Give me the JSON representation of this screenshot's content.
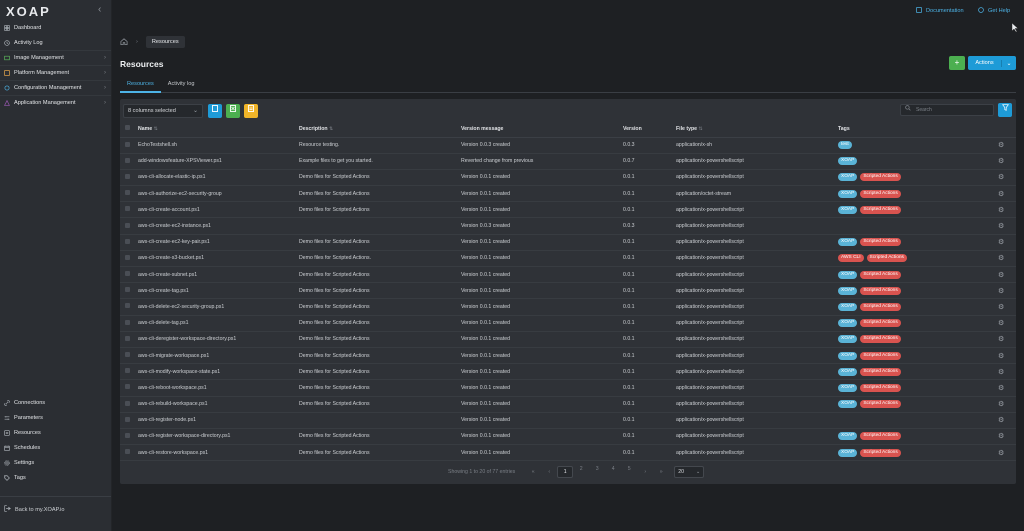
{
  "sidebar": {
    "logo": "XOAP",
    "collapse_glyph": "‹",
    "items": [
      {
        "label": "Dashboard",
        "icon": "dashboard-icon",
        "chev": false
      },
      {
        "label": "Activity Log",
        "icon": "activity-icon",
        "chev": false
      },
      {
        "label": "Image Management",
        "icon": "image-icon",
        "chev": true
      },
      {
        "label": "Platform Management",
        "icon": "platform-icon",
        "chev": true
      },
      {
        "label": "Configuration Management",
        "icon": "config-icon",
        "chev": true
      },
      {
        "label": "Application Management",
        "icon": "app-icon",
        "chev": true
      }
    ],
    "bottom_items": [
      {
        "label": "Connections",
        "icon": "link-icon"
      },
      {
        "label": "Parameters",
        "icon": "parameters-icon"
      },
      {
        "label": "Resources",
        "icon": "resources-icon"
      },
      {
        "label": "Schedules",
        "icon": "calendar-icon"
      },
      {
        "label": "Settings",
        "icon": "gear-icon"
      },
      {
        "label": "Tags",
        "icon": "tag-icon"
      }
    ],
    "back_label": "Back to my.XOAP.io"
  },
  "topbar": {
    "documentation": "Documentation",
    "help": "Get Help"
  },
  "breadcrumb": {
    "current": "Resources"
  },
  "page": {
    "title": "Resources",
    "add_label": "+",
    "actions_label": "Actions"
  },
  "tabs": [
    "Resources",
    "Activity log"
  ],
  "toolbar": {
    "columns_selected": "8 columns selected",
    "search_placeholder": "Search"
  },
  "table": {
    "headers": [
      "Name",
      "Description",
      "Version message",
      "Version",
      "File type",
      "Tags"
    ],
    "rows": [
      {
        "name": "EchoTestshell.sh",
        "description": "Resource testing.",
        "message": "Version 0.0.3 created",
        "version": "0.0.3",
        "type": "application/x-sh",
        "tags": [
          {
            "t": "test",
            "c": "#5ab3d6"
          }
        ]
      },
      {
        "name": "add-windowsfeature-XPSViewer.ps1",
        "description": "Example files to get you started.",
        "message": "Reverted change from previous",
        "version": "0.0.7",
        "type": "application/x-powershellscript",
        "tags": [
          {
            "t": "XOAP",
            "c": "#5ab3d6"
          }
        ]
      },
      {
        "name": "aws-cli-allocate-elastic-ip.ps1",
        "description": "Demo files for Scripted Actions",
        "message": "Version 0.0.1 created",
        "version": "0.0.1",
        "type": "application/x-powershellscript",
        "tags": [
          {
            "t": "XOAP",
            "c": "#5ab3d6"
          },
          {
            "t": "Scripted Actions",
            "c": "#d9534f"
          }
        ]
      },
      {
        "name": "aws-cli-authorize-ec2-security-group",
        "description": "Demo files for Scripted Actions",
        "message": "Version 0.0.1 created",
        "version": "0.0.1",
        "type": "application/octet-stream",
        "tags": [
          {
            "t": "XOAP",
            "c": "#5ab3d6"
          },
          {
            "t": "Scripted Actions",
            "c": "#d9534f"
          }
        ]
      },
      {
        "name": "aws-cli-create-account.ps1",
        "description": "Demo files for Scripted Actions",
        "message": "Version 0.0.1 created",
        "version": "0.0.1",
        "type": "application/x-powershellscript",
        "tags": [
          {
            "t": "XOAP",
            "c": "#5ab3d6"
          },
          {
            "t": "Scripted Actions",
            "c": "#d9534f"
          }
        ]
      },
      {
        "name": "aws-cli-create-ec2-instance.ps1",
        "description": "",
        "message": "Version 0.0.3 created",
        "version": "0.0.3",
        "type": "application/x-powershellscript",
        "tags": []
      },
      {
        "name": "aws-cli-create-ec2-key-pair.ps1",
        "description": "Demo files for Scripted Actions",
        "message": "Version 0.0.1 created",
        "version": "0.0.1",
        "type": "application/x-powershellscript",
        "tags": [
          {
            "t": "XOAP",
            "c": "#5ab3d6"
          },
          {
            "t": "Scripted Actions",
            "c": "#d9534f"
          }
        ]
      },
      {
        "name": "aws-cli-create-s3-bucket.ps1",
        "description": "Demo files for Scripted Actions.",
        "message": "Version 0.0.1 created",
        "version": "0.0.1",
        "type": "application/x-powershellscript",
        "tags": [
          {
            "t": "AWS CLI",
            "c": "#d9534f"
          },
          {
            "t": "Scripted Actions",
            "c": "#d9534f"
          }
        ]
      },
      {
        "name": "aws-cli-create-subnet.ps1",
        "description": "Demo files for Scripted Actions",
        "message": "Version 0.0.1 created",
        "version": "0.0.1",
        "type": "application/x-powershellscript",
        "tags": [
          {
            "t": "XOAP",
            "c": "#5ab3d6"
          },
          {
            "t": "Scripted Actions",
            "c": "#d9534f"
          }
        ]
      },
      {
        "name": "aws-cli-create-tag.ps1",
        "description": "Demo files for Scripted Actions",
        "message": "Version 0.0.1 created",
        "version": "0.0.1",
        "type": "application/x-powershellscript",
        "tags": [
          {
            "t": "XOAP",
            "c": "#5ab3d6"
          },
          {
            "t": "Scripted Actions",
            "c": "#d9534f"
          }
        ]
      },
      {
        "name": "aws-cli-delete-ec2-security-group.ps1",
        "description": "Demo files for Scripted Actions",
        "message": "Version 0.0.1 created",
        "version": "0.0.1",
        "type": "application/x-powershellscript",
        "tags": [
          {
            "t": "XOAP",
            "c": "#5ab3d6"
          },
          {
            "t": "Scripted Actions",
            "c": "#d9534f"
          }
        ]
      },
      {
        "name": "aws-cli-delete-tag.ps1",
        "description": "Demo files for Scripted Actions",
        "message": "Version 0.0.1 created",
        "version": "0.0.1",
        "type": "application/x-powershellscript",
        "tags": [
          {
            "t": "XOAP",
            "c": "#5ab3d6"
          },
          {
            "t": "Scripted Actions",
            "c": "#d9534f"
          }
        ]
      },
      {
        "name": "aws-cli-deregister-workspace-directory.ps1",
        "description": "Demo files for Scripted Actions",
        "message": "Version 0.0.1 created",
        "version": "0.0.1",
        "type": "application/x-powershellscript",
        "tags": [
          {
            "t": "XOAP",
            "c": "#5ab3d6"
          },
          {
            "t": "Scripted Actions",
            "c": "#d9534f"
          }
        ]
      },
      {
        "name": "aws-cli-migrate-workspace.ps1",
        "description": "Demo files for Scripted Actions",
        "message": "Version 0.0.1 created",
        "version": "0.0.1",
        "type": "application/x-powershellscript",
        "tags": [
          {
            "t": "XOAP",
            "c": "#5ab3d6"
          },
          {
            "t": "Scripted Actions",
            "c": "#d9534f"
          }
        ]
      },
      {
        "name": "aws-cli-modify-workspace-state.ps1",
        "description": "Demo files for Scripted Actions",
        "message": "Version 0.0.1 created",
        "version": "0.0.1",
        "type": "application/x-powershellscript",
        "tags": [
          {
            "t": "XOAP",
            "c": "#5ab3d6"
          },
          {
            "t": "Scripted Actions",
            "c": "#d9534f"
          }
        ]
      },
      {
        "name": "aws-cli-reboot-workspace.ps1",
        "description": "Demo files for Scripted Actions",
        "message": "Version 0.0.1 created",
        "version": "0.0.1",
        "type": "application/x-powershellscript",
        "tags": [
          {
            "t": "XOAP",
            "c": "#5ab3d6"
          },
          {
            "t": "Scripted Actions",
            "c": "#d9534f"
          }
        ]
      },
      {
        "name": "aws-cli-rebuild-workspace.ps1",
        "description": "Demo files for Scripted Actions",
        "message": "Version 0.0.1 created",
        "version": "0.0.1",
        "type": "application/x-powershellscript",
        "tags": [
          {
            "t": "XOAP",
            "c": "#5ab3d6"
          },
          {
            "t": "Scripted Actions",
            "c": "#d9534f"
          }
        ]
      },
      {
        "name": "aws-cli-register-node.ps1",
        "description": "",
        "message": "Version 0.0.1 created",
        "version": "0.0.1",
        "type": "application/x-powershellscript",
        "tags": []
      },
      {
        "name": "aws-cli-register-workspace-directory.ps1",
        "description": "Demo files for Scripted Actions",
        "message": "Version 0.0.1 created",
        "version": "0.0.1",
        "type": "application/x-powershellscript",
        "tags": [
          {
            "t": "XOAP",
            "c": "#5ab3d6"
          },
          {
            "t": "Scripted Actions",
            "c": "#d9534f"
          }
        ]
      },
      {
        "name": "aws-cli-restore-workspace.ps1",
        "description": "Demo files for Scripted Actions",
        "message": "Version 0.0.1 created",
        "version": "0.0.1",
        "type": "application/x-powershellscript",
        "tags": [
          {
            "t": "XOAP",
            "c": "#5ab3d6"
          },
          {
            "t": "Scripted Actions",
            "c": "#d9534f"
          }
        ]
      }
    ]
  },
  "pagination": {
    "info": "Showing 1 to 20 of 77 entries",
    "pages": [
      "1",
      "2",
      "3",
      "4",
      "5"
    ],
    "current": "1",
    "per_page": "20"
  },
  "colors": {
    "accent": "#1e9bd7",
    "add": "#4caf50",
    "tag_blue": "#5ab3d6",
    "tag_red": "#d9534f"
  }
}
